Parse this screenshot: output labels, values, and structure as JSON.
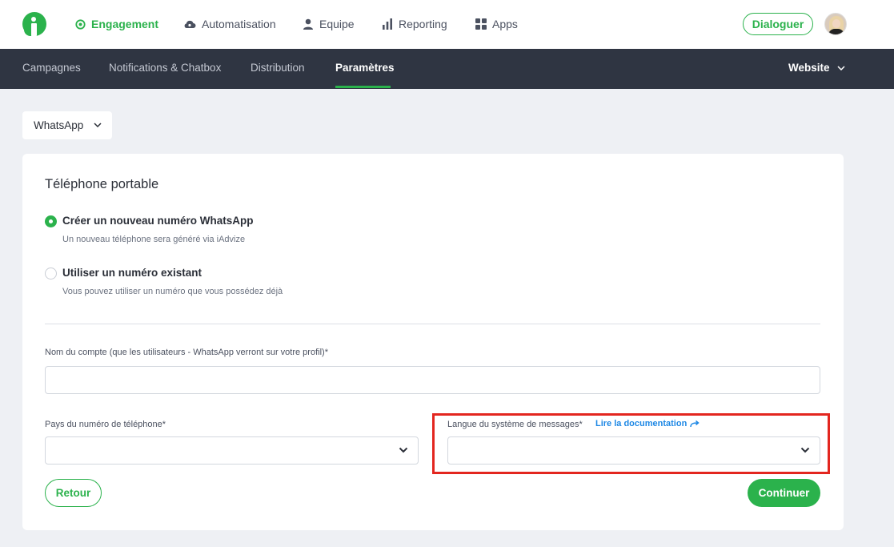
{
  "topbar": {
    "nav": [
      {
        "label": "Engagement",
        "icon": "target-icon",
        "active": true
      },
      {
        "label": "Automatisation",
        "icon": "cloud-icon",
        "active": false
      },
      {
        "label": "Equipe",
        "icon": "user-icon",
        "active": false
      },
      {
        "label": "Reporting",
        "icon": "bar-chart-icon",
        "active": false
      },
      {
        "label": "Apps",
        "icon": "grid-icon",
        "active": false
      }
    ],
    "dialoguer_label": "Dialoguer"
  },
  "subnav": {
    "items": [
      {
        "label": "Campagnes",
        "active": false
      },
      {
        "label": "Notifications & Chatbox",
        "active": false
      },
      {
        "label": "Distribution",
        "active": false
      },
      {
        "label": "Paramètres",
        "active": true
      }
    ],
    "website_label": "Website"
  },
  "channel_select": {
    "value": "WhatsApp"
  },
  "card": {
    "title": "Téléphone portable",
    "options": [
      {
        "label": "Créer un nouveau numéro WhatsApp",
        "description": "Un nouveau téléphone sera généré via iAdvize",
        "selected": true
      },
      {
        "label": "Utiliser un numéro existant",
        "description": "Vous pouvez utiliser un numéro que vous possédez déjà",
        "selected": false
      }
    ],
    "account_name_label": "Nom du compte (que les utilisateurs - WhatsApp verront sur votre profil)*",
    "account_name_value": "",
    "country_label": "Pays du numéro de téléphone*",
    "country_value": "",
    "language_label": "Langue du système de messages*",
    "language_doc_link": "Lire la documentation",
    "language_value": "",
    "back_label": "Retour",
    "continue_label": "Continuer"
  },
  "colors": {
    "brand_green": "#2bb24c",
    "subnav_bg": "#2f3542",
    "link_blue": "#1e88e5",
    "highlight_red": "#e3261f",
    "page_bg": "#eef0f4"
  }
}
